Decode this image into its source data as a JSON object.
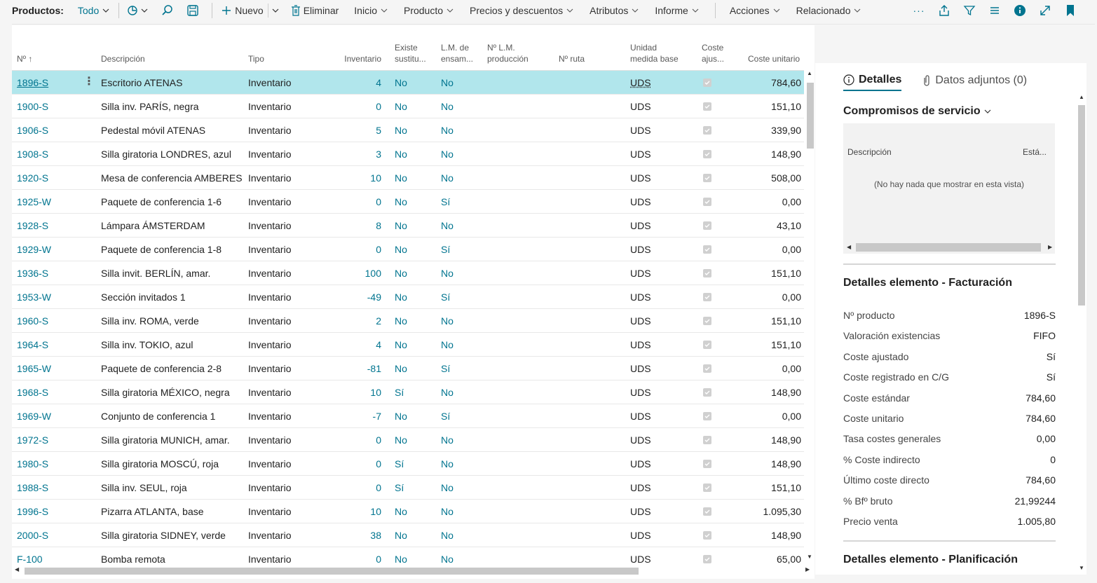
{
  "toolbar": {
    "page_label": "Productos:",
    "filter_label": "Todo",
    "new_label": "Nuevo",
    "delete_label": "Eliminar",
    "menus": [
      "Inicio",
      "Producto",
      "Precios y descuentos",
      "Atributos",
      "Informe",
      "Acciones",
      "Relacionado"
    ],
    "more_label": "···"
  },
  "columns": [
    {
      "label": "Nº ↑"
    },
    {
      "label": "Descripción"
    },
    {
      "label": "Tipo"
    },
    {
      "label": "Inventario"
    },
    {
      "label": "Existe\nsustitu..."
    },
    {
      "label": "L.M. de\nensam..."
    },
    {
      "label": "Nº L.M.\nproducción"
    },
    {
      "label": "Nº ruta"
    },
    {
      "label": "Unidad\nmedida base"
    },
    {
      "label": "Coste\najus..."
    },
    {
      "label": "Coste unitario"
    }
  ],
  "rows": [
    {
      "no": "1896-S",
      "desc": "Escritorio ATENAS",
      "type": "Inventario",
      "inv": "4",
      "sub": "No",
      "asm": "No",
      "uom": "UDS",
      "cost": "784,60"
    },
    {
      "no": "1900-S",
      "desc": "Silla inv. PARÍS, negra",
      "type": "Inventario",
      "inv": "0",
      "sub": "No",
      "asm": "No",
      "uom": "UDS",
      "cost": "151,10"
    },
    {
      "no": "1906-S",
      "desc": "Pedestal móvil ATENAS",
      "type": "Inventario",
      "inv": "5",
      "sub": "No",
      "asm": "No",
      "uom": "UDS",
      "cost": "339,90"
    },
    {
      "no": "1908-S",
      "desc": "Silla giratoria LONDRES, azul",
      "type": "Inventario",
      "inv": "3",
      "sub": "No",
      "asm": "No",
      "uom": "UDS",
      "cost": "148,90"
    },
    {
      "no": "1920-S",
      "desc": "Mesa de conferencia AMBERES",
      "type": "Inventario",
      "inv": "10",
      "sub": "No",
      "asm": "No",
      "uom": "UDS",
      "cost": "508,00"
    },
    {
      "no": "1925-W",
      "desc": "Paquete de conferencia 1-6",
      "type": "Inventario",
      "inv": "0",
      "sub": "No",
      "asm": "Sí",
      "uom": "UDS",
      "cost": "0,00"
    },
    {
      "no": "1928-S",
      "desc": "Lámpara ÁMSTERDAM",
      "type": "Inventario",
      "inv": "8",
      "sub": "No",
      "asm": "No",
      "uom": "UDS",
      "cost": "43,10"
    },
    {
      "no": "1929-W",
      "desc": "Paquete de conferencia 1-8",
      "type": "Inventario",
      "inv": "0",
      "sub": "No",
      "asm": "Sí",
      "uom": "UDS",
      "cost": "0,00"
    },
    {
      "no": "1936-S",
      "desc": "Silla invit. BERLÍN, amar.",
      "type": "Inventario",
      "inv": "100",
      "sub": "No",
      "asm": "No",
      "uom": "UDS",
      "cost": "151,10"
    },
    {
      "no": "1953-W",
      "desc": "Sección invitados 1",
      "type": "Inventario",
      "inv": "-49",
      "sub": "No",
      "asm": "Sí",
      "uom": "UDS",
      "cost": "0,00"
    },
    {
      "no": "1960-S",
      "desc": "Silla inv. ROMA, verde",
      "type": "Inventario",
      "inv": "2",
      "sub": "No",
      "asm": "No",
      "uom": "UDS",
      "cost": "151,10"
    },
    {
      "no": "1964-S",
      "desc": "Silla inv. TOKIO, azul",
      "type": "Inventario",
      "inv": "4",
      "sub": "No",
      "asm": "No",
      "uom": "UDS",
      "cost": "151,10"
    },
    {
      "no": "1965-W",
      "desc": "Paquete de conferencia 2-8",
      "type": "Inventario",
      "inv": "-81",
      "sub": "No",
      "asm": "Sí",
      "uom": "UDS",
      "cost": "0,00"
    },
    {
      "no": "1968-S",
      "desc": "Silla giratoria MÉXICO, negra",
      "type": "Inventario",
      "inv": "10",
      "sub": "Sí",
      "asm": "No",
      "uom": "UDS",
      "cost": "148,90"
    },
    {
      "no": "1969-W",
      "desc": "Conjunto de conferencia 1",
      "type": "Inventario",
      "inv": "-7",
      "sub": "No",
      "asm": "Sí",
      "uom": "UDS",
      "cost": "0,00"
    },
    {
      "no": "1972-S",
      "desc": "Silla giratoria MUNICH, amar.",
      "type": "Inventario",
      "inv": "0",
      "sub": "No",
      "asm": "No",
      "uom": "UDS",
      "cost": "148,90"
    },
    {
      "no": "1980-S",
      "desc": "Silla giratoria MOSCÚ, roja",
      "type": "Inventario",
      "inv": "0",
      "sub": "Sí",
      "asm": "No",
      "uom": "UDS",
      "cost": "148,90"
    },
    {
      "no": "1988-S",
      "desc": "Silla inv. SEUL, roja",
      "type": "Inventario",
      "inv": "0",
      "sub": "Sí",
      "asm": "No",
      "uom": "UDS",
      "cost": "151,10"
    },
    {
      "no": "1996-S",
      "desc": "Pizarra ATLANTA, base",
      "type": "Inventario",
      "inv": "10",
      "sub": "No",
      "asm": "No",
      "uom": "UDS",
      "cost": "1.095,30"
    },
    {
      "no": "2000-S",
      "desc": "Silla giratoria SIDNEY, verde",
      "type": "Inventario",
      "inv": "38",
      "sub": "No",
      "asm": "No",
      "uom": "UDS",
      "cost": "148,90"
    },
    {
      "no": "F-100",
      "desc": "Bomba remota",
      "type": "Inventario",
      "inv": "0",
      "sub": "No",
      "asm": "No",
      "uom": "UDS",
      "cost": "65,00"
    }
  ],
  "factbox": {
    "tab_details": "Detalles",
    "tab_attachments": "Datos adjuntos (0)",
    "service_title": "Compromisos de servicio",
    "service_col_desc": "Descripción",
    "service_col_status": "Está...",
    "service_empty": "(No hay nada que mostrar en esta vista)",
    "invoicing_title": "Detalles elemento - Facturación",
    "invoicing": [
      {
        "k": "Nº producto",
        "v": "1896-S"
      },
      {
        "k": "Valoración existencias",
        "v": "FIFO"
      },
      {
        "k": "Coste ajustado",
        "v": "Sí"
      },
      {
        "k": "Coste registrado en C/G",
        "v": "Sí"
      },
      {
        "k": "Coste estándar",
        "v": "784,60"
      },
      {
        "k": "Coste unitario",
        "v": "784,60"
      },
      {
        "k": "Tasa costes generales",
        "v": "0,00"
      },
      {
        "k": "% Coste indirecto",
        "v": "0"
      },
      {
        "k": "Último coste directo",
        "v": "784,60"
      },
      {
        "k": "% Bfº bruto",
        "v": "21,99244"
      },
      {
        "k": "Precio venta",
        "v": "1.005,80"
      }
    ],
    "planning_title": "Detalles elemento - Planificación"
  }
}
